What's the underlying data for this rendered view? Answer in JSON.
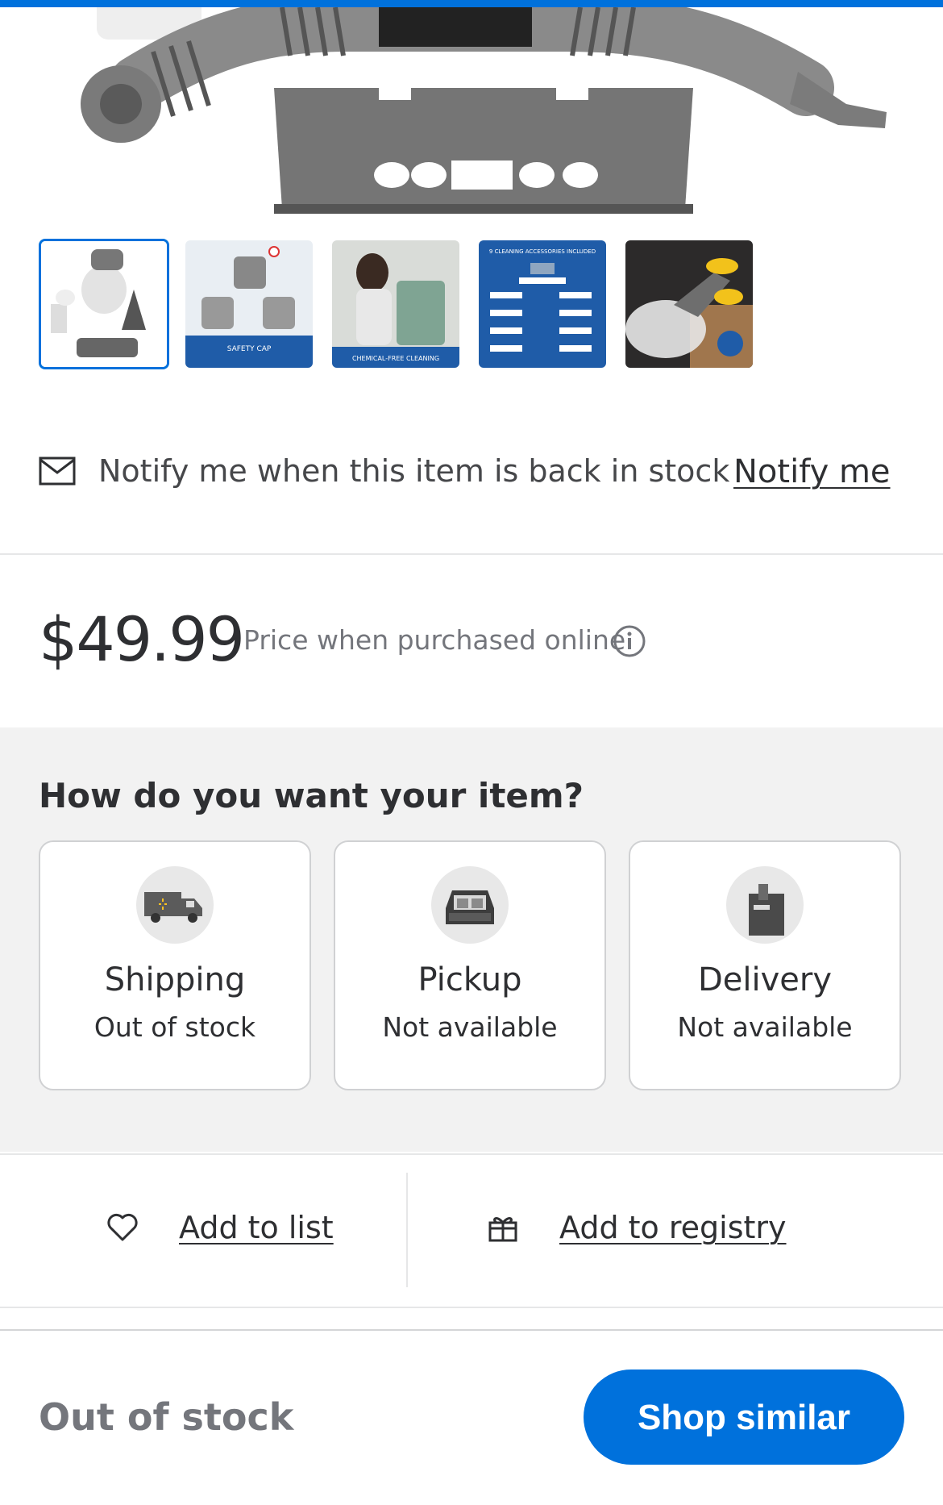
{
  "gallery": {
    "thumbnails": [
      {
        "name": "thumb-product-kit",
        "selected": true,
        "caption": ""
      },
      {
        "name": "thumb-safety-cap",
        "selected": false,
        "caption": "SAFETY CAP"
      },
      {
        "name": "thumb-chemical-free",
        "selected": false,
        "caption": "CHEMICAL-FREE CLEANING"
      },
      {
        "name": "thumb-accessories",
        "selected": false,
        "caption": "9 CLEANING ACCESSORIES INCLUDED"
      },
      {
        "name": "thumb-steam-use",
        "selected": false,
        "caption": ""
      }
    ]
  },
  "notify": {
    "text": "Notify me when this item is back in stock",
    "link": "Notify me",
    "icon": "mail-icon"
  },
  "price": {
    "amount": "$49.99",
    "note": "Price when purchased online",
    "icon": "info-icon"
  },
  "fulfillment": {
    "title": "How do you want your item?",
    "options": [
      {
        "title": "Shipping",
        "status": "Out of stock",
        "icon": "truck-icon"
      },
      {
        "title": "Pickup",
        "status": "Not available",
        "icon": "car-icon"
      },
      {
        "title": "Delivery",
        "status": "Not available",
        "icon": "bag-icon"
      }
    ]
  },
  "actions": {
    "add_to_list": "Add to list",
    "add_to_registry": "Add to registry"
  },
  "footer": {
    "status": "Out of stock",
    "button": "Shop similar"
  },
  "colors": {
    "brand_blue": "#0071dc",
    "text": "#2e2f32",
    "muted": "#74767c",
    "panel_bg": "#f2f2f2"
  }
}
